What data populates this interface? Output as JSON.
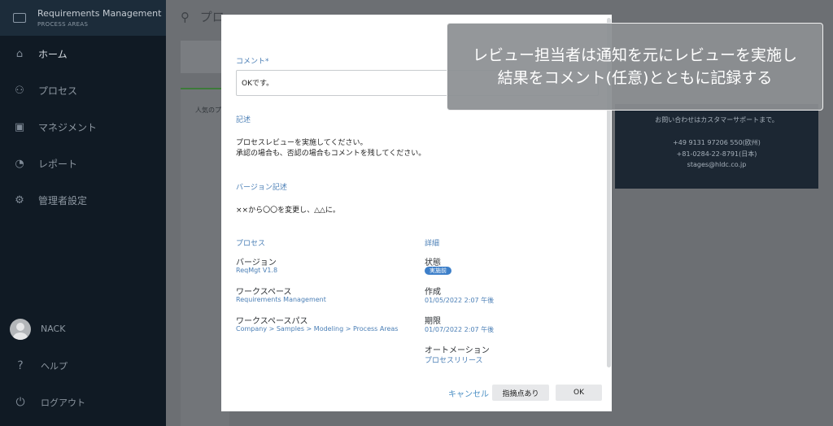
{
  "sidebar": {
    "header_title": "Requirements Management",
    "header_subtitle": "PROCESS AREAS",
    "items": [
      {
        "label": "ホーム",
        "icon": "home-icon"
      },
      {
        "label": "プロセス",
        "icon": "process-icon"
      },
      {
        "label": "マネジメント",
        "icon": "management-icon"
      },
      {
        "label": "レポート",
        "icon": "report-icon"
      },
      {
        "label": "管理者設定",
        "icon": "gear-icon"
      }
    ],
    "user_name": "NACK",
    "help_label": "ヘルプ",
    "logout_label": "ログアウト"
  },
  "background": {
    "search_text": "プロ",
    "panel_heading": "人気のプ",
    "support_text": "お問い合わせはカスタマーサポートまで。",
    "support_phone1": "+49 9131 97206 550(欧州)",
    "support_phone2": "+81-0284-22-8791(日本)",
    "support_email": "stages@hldc.co.jp"
  },
  "modal": {
    "comment_label": "コメント*",
    "comment_value": "OKです。",
    "description_label": "記述",
    "description_line1": "プロセスレビューを実施してください。",
    "description_line2": "承認の場合も、否認の場合もコメントを残してください。",
    "version_desc_label": "バージョン記述",
    "version_desc_text": "××から〇〇を変更し、△△に。",
    "process_heading": "プロセス",
    "version_label": "バージョン",
    "version_value": "ReqMgt V1.8",
    "workspace_label": "ワークスペース",
    "workspace_value": "Requirements Management",
    "workspace_path_label": "ワークスペースパス",
    "workspace_path_value": "Company > Samples > Modeling > Process Areas",
    "details_heading": "詳細",
    "status_label": "状態",
    "status_badge": "実施前",
    "created_label": "作成",
    "created_value": "01/05/2022 2:07 午後",
    "due_label": "期限",
    "due_value": "01/07/2022 2:07 午後",
    "automation_label": "オートメーション",
    "automation_value": "プロセスリリース",
    "cancel_label": "キャンセル",
    "flag_label": "指摘点あり",
    "ok_label": "OK"
  },
  "callout": {
    "line1": "レビュー担当者は通知を元にレビューを実施し",
    "line2": "結果をコメント(任意)とともに記録する"
  },
  "colors": {
    "accent": "#4b7fb6",
    "sidebar_bg": "#101a24",
    "badge": "#3d7fc9"
  }
}
